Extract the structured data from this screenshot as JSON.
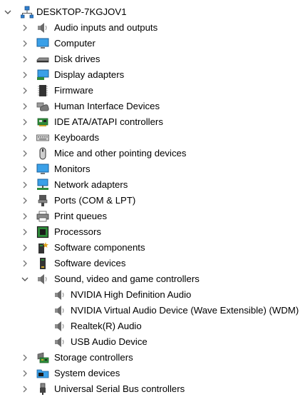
{
  "tree": {
    "root": {
      "label": "DESKTOP-7KGJOV1",
      "icon": "computer-network-icon",
      "expanded": true
    },
    "categories_a": [
      {
        "label": "Audio inputs and outputs",
        "icon": "speaker-icon"
      },
      {
        "label": "Computer",
        "icon": "monitor-icon"
      },
      {
        "label": "Disk drives",
        "icon": "disk-drive-icon"
      },
      {
        "label": "Display adapters",
        "icon": "display-adapter-icon"
      },
      {
        "label": "Firmware",
        "icon": "firmware-chip-icon"
      },
      {
        "label": "Human Interface Devices",
        "icon": "hid-icon"
      },
      {
        "label": "IDE ATA/ATAPI controllers",
        "icon": "ide-controller-icon"
      },
      {
        "label": "Keyboards",
        "icon": "keyboard-icon"
      },
      {
        "label": "Mice and other pointing devices",
        "icon": "mouse-icon"
      },
      {
        "label": "Monitors",
        "icon": "monitor-icon"
      },
      {
        "label": "Network adapters",
        "icon": "network-adapter-icon"
      },
      {
        "label": "Ports (COM & LPT)",
        "icon": "port-icon"
      },
      {
        "label": "Print queues",
        "icon": "printer-icon"
      },
      {
        "label": "Processors",
        "icon": "processor-icon"
      },
      {
        "label": "Software components",
        "icon": "software-component-icon"
      },
      {
        "label": "Software devices",
        "icon": "software-device-icon"
      }
    ],
    "sound": {
      "label": "Sound, video and game controllers",
      "icon": "speaker-icon",
      "expanded": true,
      "children": [
        {
          "label": "NVIDIA High Definition Audio",
          "icon": "speaker-icon"
        },
        {
          "label": "NVIDIA Virtual Audio Device (Wave Extensible) (WDM)",
          "icon": "speaker-icon"
        },
        {
          "label": "Realtek(R) Audio",
          "icon": "speaker-icon"
        },
        {
          "label": "USB Audio Device",
          "icon": "speaker-icon"
        }
      ]
    },
    "categories_b": [
      {
        "label": "Storage controllers",
        "icon": "storage-controller-icon"
      },
      {
        "label": "System devices",
        "icon": "system-folder-icon"
      },
      {
        "label": "Universal Serial Bus controllers",
        "icon": "usb-icon"
      }
    ]
  },
  "colors": {
    "chevron": "#6b6b6b",
    "accent": "#1f87d6"
  }
}
